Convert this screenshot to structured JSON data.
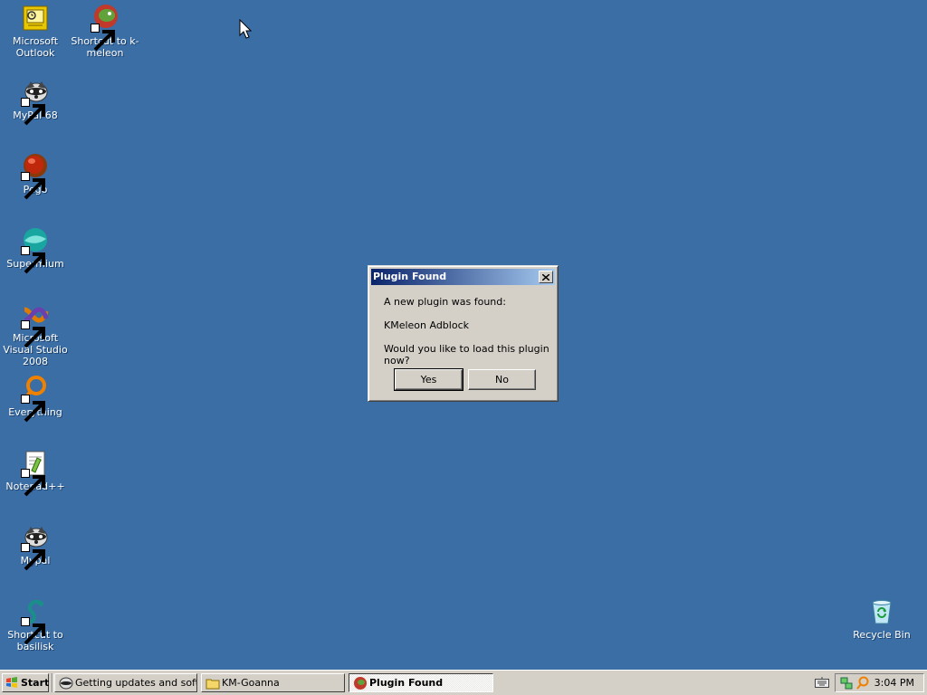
{
  "desktop": {
    "icons": [
      {
        "label": "Microsoft Outlook",
        "icon": "outlook-icon"
      },
      {
        "label": "Shortcut to k-meleon",
        "icon": "kmeleon-icon"
      },
      {
        "label": "MyPal 68",
        "icon": "mypal-icon"
      },
      {
        "label": "Pego",
        "icon": "pego-icon"
      },
      {
        "label": "Supermium",
        "icon": "supermium-icon"
      },
      {
        "label": "Microsoft Visual Studio 2008",
        "icon": "visual-studio-icon"
      },
      {
        "label": "Everything",
        "icon": "everything-icon"
      },
      {
        "label": "Notepad++",
        "icon": "notepadpp-icon"
      },
      {
        "label": "Mypal",
        "icon": "mypal-icon"
      },
      {
        "label": "Shortcut to basilisk",
        "icon": "basilisk-icon"
      },
      {
        "label": "Recycle Bin",
        "icon": "recycle-bin-icon"
      }
    ],
    "background_color": "#3a6ea5"
  },
  "dialog": {
    "title": "Plugin Found",
    "line1": "A new plugin was found:",
    "plugin_name": "KMeleon Adblock",
    "question": "Would you like to load this plugin now?",
    "yes_label": "Yes",
    "no_label": "No"
  },
  "taskbar": {
    "start_label": "Start",
    "tasks": [
      {
        "label": "Getting updates and soft...",
        "icon": "mypal-icon"
      },
      {
        "label": "KM-Goanna",
        "icon": "folder-icon"
      },
      {
        "label": "Plugin Found",
        "icon": "kmeleon-icon"
      }
    ],
    "clock": "3:04 PM",
    "tray_icons": [
      "keyboard-icon",
      "network-icon",
      "search-icon"
    ]
  }
}
